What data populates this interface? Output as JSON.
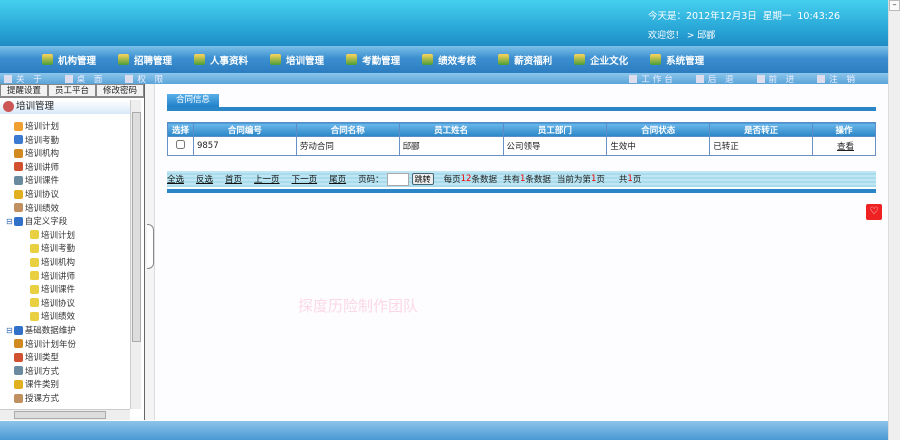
{
  "header": {
    "date_line": "今天是：2012年12月3日  星期一  10:43:26",
    "welcome": "欢迎您！ > 邱郦"
  },
  "menu": [
    "机构管理",
    "招聘管理",
    "人事资料",
    "培训管理",
    "考勤管理",
    "绩效考核",
    "薪资福利",
    "企业文化",
    "系统管理"
  ],
  "toolbar_left": [
    "关 于",
    "桌 面",
    "权 限"
  ],
  "toolbar_right": [
    "工作台",
    "后 退",
    "前 进",
    "注 销"
  ],
  "side_tabs": [
    "提醒设置",
    "员工平台",
    "修改密码"
  ],
  "tree": {
    "root": "培训管理",
    "items": [
      {
        "label": "培训计划",
        "level": 1
      },
      {
        "label": "培训考勤",
        "level": 1
      },
      {
        "label": "培训机构",
        "level": 1
      },
      {
        "label": "培训讲师",
        "level": 1
      },
      {
        "label": "培训课件",
        "level": 1
      },
      {
        "label": "培训协议",
        "level": 1
      },
      {
        "label": "培训绩效",
        "level": 1
      },
      {
        "label": "自定义字段",
        "level": 0
      },
      {
        "label": "培训计划",
        "level": 2
      },
      {
        "label": "培训考勤",
        "level": 2
      },
      {
        "label": "培训机构",
        "level": 2
      },
      {
        "label": "培训讲师",
        "level": 2
      },
      {
        "label": "培训课件",
        "level": 2
      },
      {
        "label": "培训协议",
        "level": 2
      },
      {
        "label": "培训绩效",
        "level": 2
      },
      {
        "label": "基础数据维护",
        "level": 0
      },
      {
        "label": "培训计划年份",
        "level": 1
      },
      {
        "label": "培训类型",
        "level": 1
      },
      {
        "label": "培训方式",
        "level": 1
      },
      {
        "label": "课件类别",
        "level": 1
      },
      {
        "label": "授课方式",
        "level": 1
      }
    ]
  },
  "content": {
    "tab": "合同信息",
    "columns": [
      "选择",
      "合同编号",
      "合同名称",
      "员工姓名",
      "员工部门",
      "合同状态",
      "是否转正",
      "操作"
    ],
    "rows": [
      {
        "id": "9857",
        "name": "劳动合同",
        "employee": "邱郦",
        "dept": "公司领导",
        "status": "生效中",
        "regular": "已转正",
        "action": "查看"
      }
    ],
    "pager": {
      "links": [
        "全选",
        "反选",
        "首页",
        "上一页",
        "下一页",
        "尾页"
      ],
      "page_label": "页码：",
      "go": "跳转",
      "per_page_pre": "每页",
      "per_page": "12",
      "per_page_post": "条数据",
      "total_pre": "共有",
      "total": "1",
      "total_post": "条数据",
      "cur_pre": "当前为第",
      "cur": "1",
      "cur_post": "页",
      "pages_pre": "共",
      "pages": "1",
      "pages_post": "页"
    }
  },
  "watermark": "探度历险制作团队"
}
